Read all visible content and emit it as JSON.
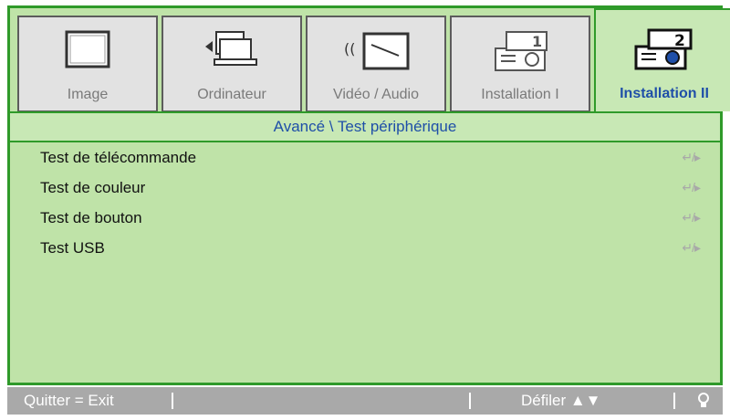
{
  "tabs": [
    {
      "label": "Image",
      "icon": "monitor-icon",
      "active": false
    },
    {
      "label": "Ordinateur",
      "icon": "computer-icon",
      "active": false
    },
    {
      "label": "Vidéo / Audio",
      "icon": "video-audio-icon",
      "active": false
    },
    {
      "label": "Installation I",
      "icon": "projector-1-icon",
      "active": false
    },
    {
      "label": "Installation II",
      "icon": "projector-2-icon",
      "active": true
    }
  ],
  "subtitle": "Avancé \\ Test périphérique",
  "items": [
    {
      "label": "Test de télécommande",
      "action": "↵/▸"
    },
    {
      "label": "Test de couleur",
      "action": "↵/▸"
    },
    {
      "label": "Test de bouton",
      "action": "↵/▸"
    },
    {
      "label": "Test USB",
      "action": "↵/▸"
    }
  ],
  "footer": {
    "quit": "Quitter = Exit",
    "scroll": "Défiler ▲▼",
    "bulb_icon": "lightbulb-icon"
  },
  "colors": {
    "panel": "#bfe3a8",
    "border": "#2f9a2a",
    "active_label": "#1f4fa8",
    "footer": "#a9a9a9"
  }
}
